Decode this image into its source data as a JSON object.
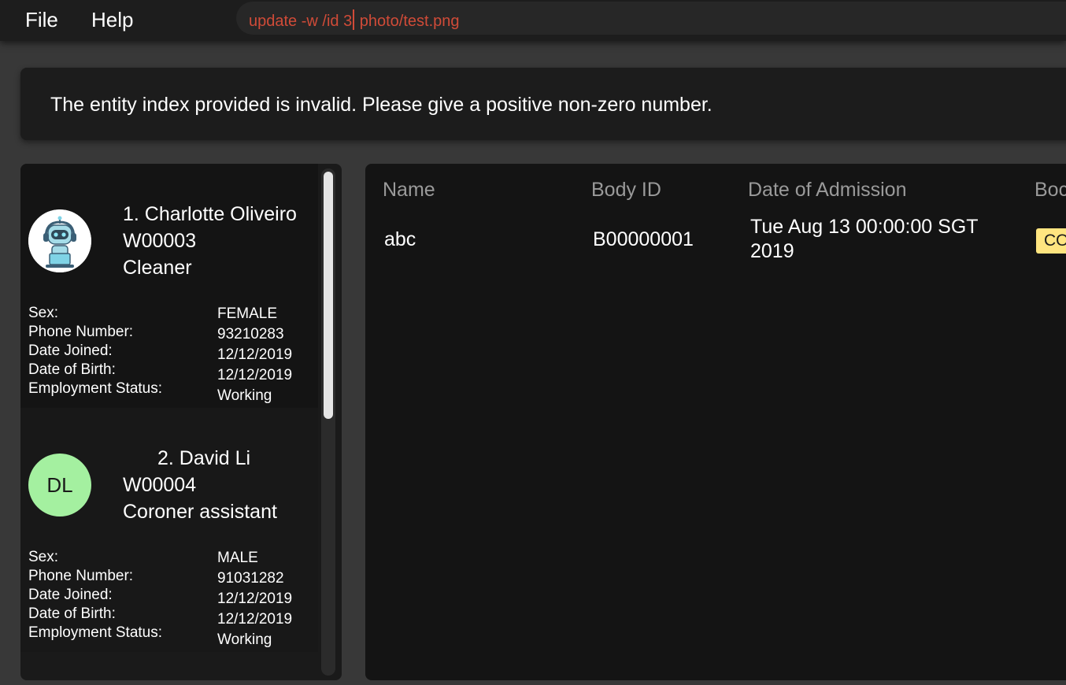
{
  "menu": {
    "file": "File",
    "help": "Help"
  },
  "command": {
    "before_caret": "update -w /id 3",
    "after_caret": " photo/test.png"
  },
  "result": {
    "message": "The entity index provided is invalid. Please give a positive non-zero number."
  },
  "workers": [
    {
      "index_name": "1. Charlotte Oliveiro",
      "id": "W00003",
      "designation": "Cleaner",
      "avatar_icon": "robot-avatar-icon",
      "details": {
        "sex_label": "Sex:",
        "sex": "FEMALE",
        "phone_label": "Phone Number:",
        "phone": "93210283",
        "joined_label": "Date Joined:",
        "joined": "12/12/2019",
        "dob_label": "Date of Birth:",
        "dob": "12/12/2019",
        "status_label": "Employment Status:",
        "status": "Working"
      }
    },
    {
      "index_name": "2. David Li",
      "id": "W00004",
      "designation": "Coroner assistant",
      "initials": "DL",
      "avatar_color": "#a4f0a0",
      "details": {
        "sex_label": "Sex:",
        "sex": "MALE",
        "phone_label": "Phone Number:",
        "phone": "91031282",
        "joined_label": "Date Joined:",
        "joined": "12/12/2019",
        "dob_label": "Date of Birth:",
        "dob": "12/12/2019",
        "status_label": "Employment Status:",
        "status": "Working"
      }
    }
  ],
  "table": {
    "headers": [
      "Name",
      "Body ID",
      "Date of Admission",
      "Boc"
    ],
    "rows": [
      {
        "name": "abc",
        "body_id": "B00000001",
        "date_line1": "Tue Aug 13 00:00:00 SGT",
        "date_line2": "2019",
        "status": "CO"
      }
    ]
  },
  "colors": {
    "command_text": "#d04b38",
    "status_tag": "#ffe580",
    "initials_avatar": "#a4f0a0"
  }
}
